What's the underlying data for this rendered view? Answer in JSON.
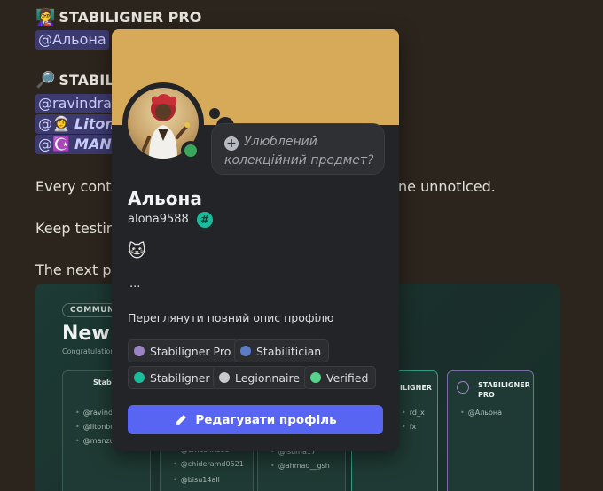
{
  "chat": {
    "title1_emoji": "👩‍🏫",
    "title1": "STABILIGNER PRO",
    "mention1": "@Альона",
    "title2_emoji": "🔎",
    "title2": "STABILI",
    "mention2": "@ravindra8",
    "mention3_prefix": "@",
    "mention3_emoji": "👩‍🚀",
    "mention3": "Liton",
    "mention4_prefix": "@",
    "mention4_emoji": "☪️",
    "mention4": "MAN",
    "text1": "Every contri",
    "text1_tail": "ne unnoticed.",
    "text2": "Keep testing",
    "text3": "The next pro"
  },
  "embed": {
    "pill": "COMMUNIT",
    "big": "New F",
    "small": "Congratulations",
    "card1": {
      "title": "Stabil",
      "users": [
        "@ravindral",
        "@litonbd.0",
        "@manzu12"
      ]
    },
    "card2": {
      "users": [
        "@omachris98",
        "@chideramd0521",
        "@bisu14all"
      ]
    },
    "card3": {
      "users": [
        "@isuma17",
        "@ahmad__gsh"
      ]
    },
    "card4": {
      "title": "ILIGNER",
      "users": [
        "rd_x",
        "fx"
      ]
    },
    "card5": {
      "title": "STABILIGNER PRO",
      "users": [
        "@Альона"
      ]
    }
  },
  "profile": {
    "collectible_placeholder": "Улюблений колекційний предмет?",
    "display_name": "Альона",
    "username": "alona9588",
    "badge": "#",
    "bio_emoji": "🐱",
    "bio_more": "...",
    "view_full_profile": "Переглянути повний опис профілю",
    "roles": [
      {
        "name": "Stabiligner Pro",
        "color": "#9b84c4"
      },
      {
        "name": "Stabilitician",
        "color": "#5b7bc6"
      },
      {
        "name": "Stabiligner",
        "color": "#1abc9c"
      },
      {
        "name": "Legionnaire",
        "color": "#c7c9cc"
      },
      {
        "name": "Verified",
        "color": "#57d38c"
      }
    ],
    "edit_button": "Редагувати профіль",
    "banner_color": "#d6aa58",
    "status_color": "#3ba55c",
    "accent_color": "#5865f2"
  }
}
